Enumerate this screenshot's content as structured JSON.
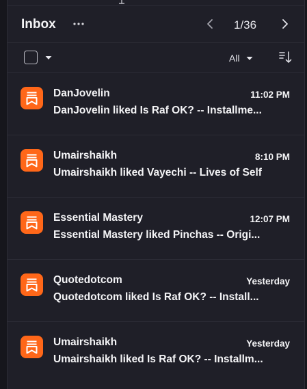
{
  "header": {
    "title": "Inbox",
    "pagination": "1/36"
  },
  "toolbar": {
    "filter_label": "All"
  },
  "messages": [
    {
      "sender": "DanJovelin",
      "time": "11:02 PM",
      "subject": "DanJovelin liked Is Raf OK? -- Installme..."
    },
    {
      "sender": "Umairshaikh",
      "time": "8:10 PM",
      "subject": "Umairshaikh liked Vayechi -- Lives of Self"
    },
    {
      "sender": "Essential Mastery",
      "time": "12:07 PM",
      "subject": "Essential Mastery liked Pinchas -- Origi..."
    },
    {
      "sender": "Quotedotcom",
      "time": "Yesterday",
      "subject": "Quotedotcom liked Is Raf OK? -- Install..."
    },
    {
      "sender": "Umairshaikh",
      "time": "Yesterday",
      "subject": "Umairshaikh liked Is Raf OK? -- Installm..."
    }
  ],
  "icons": {
    "app": "substack-bookmark-icon",
    "more": "more-horizontal-icon",
    "prev": "chevron-left-icon",
    "next": "chevron-right-icon",
    "caret": "caret-down-icon",
    "sort": "sort-icon"
  },
  "colors": {
    "background": "#1f1f28",
    "accent": "#ff6719",
    "text": "#f4f4f6",
    "divider": "#2c2c36"
  }
}
